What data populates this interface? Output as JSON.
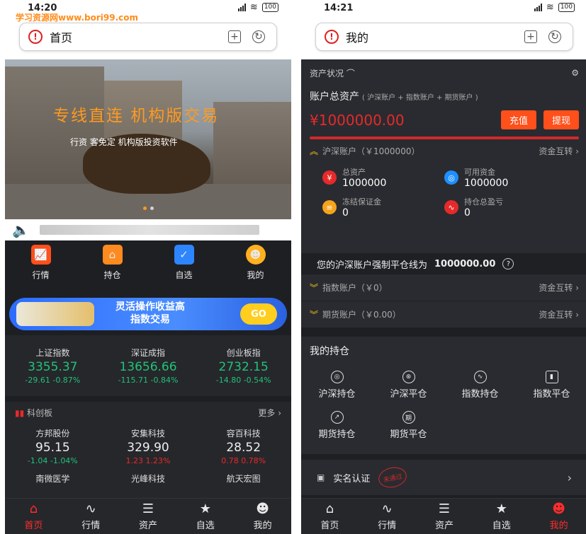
{
  "watermark": "学习资源网www.bori99.com",
  "left": {
    "status": {
      "time": "14:20",
      "battery": "100"
    },
    "url_title": "首页",
    "banner": {
      "headline": "专线直连 机构版交易",
      "subline": "行资 客免定 机构版投资软件"
    },
    "quick": [
      {
        "label": "行情",
        "icon": "chart-icon",
        "color": "#ff4f1a"
      },
      {
        "label": "持仓",
        "icon": "home-chart-icon",
        "color": "#ff8a1f"
      },
      {
        "label": "自选",
        "icon": "shield-check-icon",
        "color": "#2e86ff"
      },
      {
        "label": "我的",
        "icon": "user-icon",
        "color": "#ffb01f"
      }
    ],
    "promo": {
      "line1": "灵活操作收益高",
      "line2": "指数交易",
      "go": "GO"
    },
    "indices": [
      {
        "name": "上证指数",
        "value": "3355.37",
        "change": "-29.61 -0.87%"
      },
      {
        "name": "深证成指",
        "value": "13656.66",
        "change": "-115.71 -0.84%"
      },
      {
        "name": "创业板指",
        "value": "2732.15",
        "change": "-14.80 -0.54%"
      }
    ],
    "kcb": {
      "title": "科创板",
      "more": "更多",
      "stocks": [
        {
          "name": "方邦股份",
          "value": "95.15",
          "change": "-1.04 -1.04%",
          "color": "#21c27a"
        },
        {
          "name": "安集科技",
          "value": "329.90",
          "change": "1.23 1.23%",
          "color": "#e62a2a"
        },
        {
          "name": "容百科技",
          "value": "28.52",
          "change": "0.78 0.78%",
          "color": "#e62a2a"
        }
      ],
      "row2": [
        "南微医学",
        "光峰科技",
        "航天宏图"
      ]
    },
    "tabs": [
      "首页",
      "行情",
      "资产",
      "自选",
      "我的"
    ]
  },
  "right": {
    "status": {
      "time": "14:21",
      "battery": "100"
    },
    "url_title": "我的",
    "asset_label": "资产状况",
    "acct_title": "账户总资产",
    "acct_note": "( 沪深账户 + 指数账户 + 期货账户 )",
    "balance": "¥1000000.00",
    "recharge": "充值",
    "withdraw": "提现",
    "hs_account": "沪深账户（￥1000000）",
    "transfer": "资金互转",
    "stats": [
      {
        "label": "总资产",
        "value": "1000000",
        "color": "#e62a2a",
        "icon": "money-bag-icon"
      },
      {
        "label": "可用资金",
        "value": "1000000",
        "color": "#1f8fff",
        "icon": "wallet-icon"
      },
      {
        "label": "冻结保证金",
        "value": "0",
        "color": "#f5a31c",
        "icon": "coins-icon"
      },
      {
        "label": "持仓总盈亏",
        "value": "0",
        "color": "#e62a2a",
        "icon": "pulse-icon"
      }
    ],
    "liq_text": "您的沪深账户强制平仓线为",
    "liq_value": "1000000.00",
    "index_account": "指数账户（￥0）",
    "futures_account": "期货账户（￥0.00）",
    "holdings_title": "我的持仓",
    "holdings": [
      {
        "label": "沪深持仓",
        "icon": "position-icon"
      },
      {
        "label": "沪深平仓",
        "icon": "close-position-icon"
      },
      {
        "label": "指数持仓",
        "icon": "index-chart-icon"
      },
      {
        "label": "指数平仓",
        "icon": "bar-chart-icon"
      },
      {
        "label": "期货持仓",
        "icon": "futures-icon"
      },
      {
        "label": "期货平仓",
        "icon": "qi-icon"
      }
    ],
    "verify": "实名认证",
    "verify_stamp": "未通过",
    "tabs": [
      "首页",
      "行情",
      "资产",
      "自选",
      "我的"
    ]
  }
}
